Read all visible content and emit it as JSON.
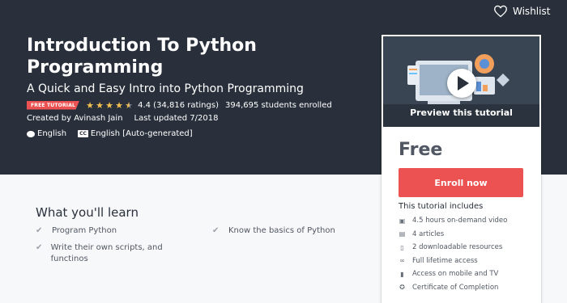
{
  "header": {
    "wishlist_label": "Wishlist",
    "title": "Introduction To Python Programming",
    "subtitle": "A Quick and Easy Intro into Python Programming",
    "badge": "FREE TUTORIAL",
    "rating": "4.4 (34,816 ratings)",
    "rating_value": 4.4,
    "students": "394,695 students enrolled",
    "created_by": "Created by Avinash Jain",
    "last_updated": "Last updated 7/2018",
    "language": "English",
    "captions": "English [Auto-generated]",
    "captions_icon_text": "CC"
  },
  "card": {
    "preview_label": "Preview this tutorial",
    "price": "Free",
    "enroll_label": "Enroll now",
    "includes_title": "This tutorial includes",
    "includes": [
      {
        "icon": "video-icon",
        "label": "4.5 hours on-demand video"
      },
      {
        "icon": "article-icon",
        "label": "4 articles"
      },
      {
        "icon": "file-icon",
        "label": "2 downloadable resources"
      },
      {
        "icon": "infinity-icon",
        "label": "Full lifetime access"
      },
      {
        "icon": "mobile-icon",
        "label": "Access on mobile and TV"
      },
      {
        "icon": "certificate-icon",
        "label": "Certificate of Completion"
      }
    ]
  },
  "learn": {
    "title": "What you'll learn",
    "items": [
      "Program Python",
      "Write their own scripts, and functinos",
      "Know the basics of Python"
    ]
  },
  "colors": {
    "hero_bg": "#29303b",
    "accent": "#ec5252",
    "star": "#f4c150"
  }
}
